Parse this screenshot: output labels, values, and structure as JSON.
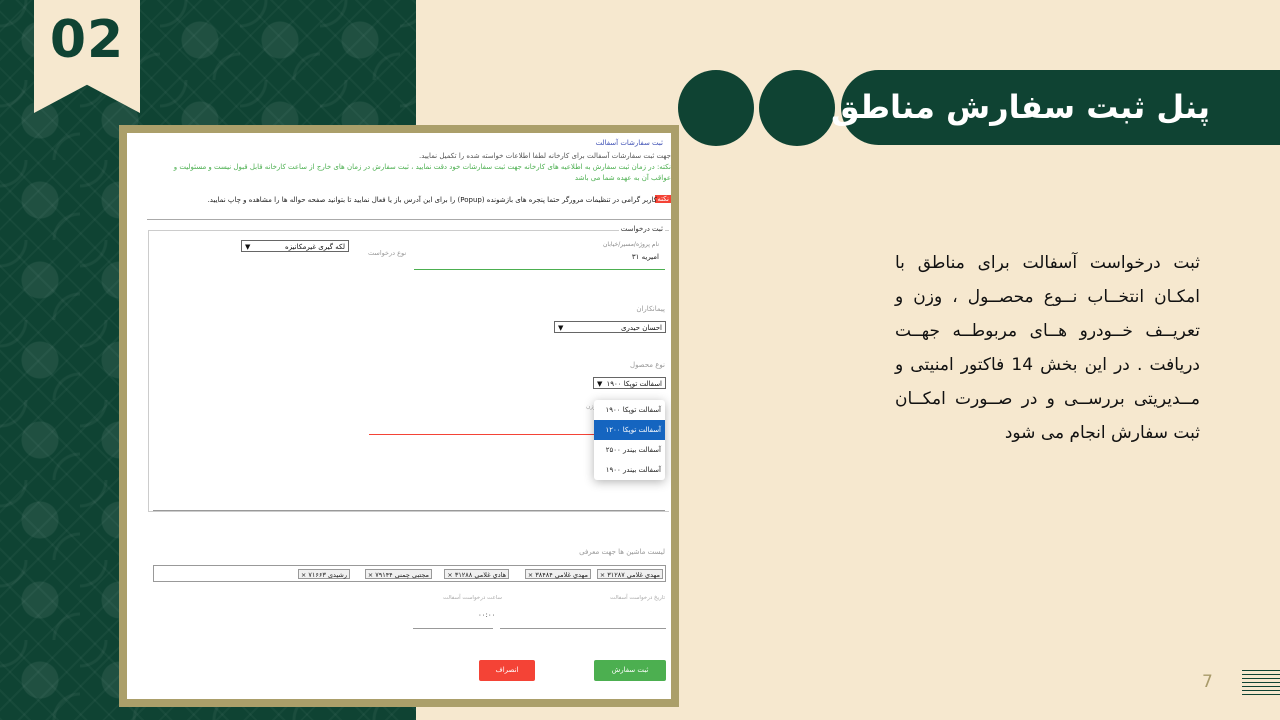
{
  "slide": {
    "number": "02",
    "title": "پنل ثبت سفارش مناطق",
    "description": "ثبت درخواست آسفالت برای مناطق با امکـان انتخــاب نــوع محصــول ، وزن و تعریــف خــودرو هــای مربوطــه جهــت دریافت . در این بخش 14 فاکتور امنیتی و مــدیریتی بررســی و در صــورت امکــان ثبت سفارش انجام می شود",
    "page_number": "7"
  },
  "screenshot": {
    "header_title": "ثبت سفارشات آسفالت",
    "intro_line": "جهت ثبت سفارشات آسفالت برای کارخانه لطفا اطلاعات خواسته شده را تکمیل نمایید.",
    "note_line1": "نکته: در زمان ثبت سفارش به اطلاعیه های کارخانه جهت ثبت سفارشات خود دقت نمایید ، ثبت سفارش در زمان های خارج از ساعت کارخانه قابل قبول نیست و مسئولیت و",
    "note_line2": "عواقب آن به عهده شما می باشد",
    "warning_badge": "نکته",
    "warning_text": "کاربر گرامی در تنظیمات مرورگر حتما پنجره های بازشونده (Popup) را برای این آدرس باز یا فعال نمایید تا بتوانید صفحه حواله ها را مشاهده و چاپ نمایید.",
    "section_title": "ثبت درخواست",
    "project_label": "نام پروژه/مسیر/خیابان",
    "project_value": "امیریه ۳۱",
    "request_type_label": "نوع درخواست",
    "request_type_value": "لکه گیری غیرمکانیزه",
    "contractor_label": "پیمانکاران",
    "contractor_value": "احسان حیدری",
    "product_label": "نوع محصول",
    "product_value": "اسفالت توپکا ۱۹۰۰",
    "product_options": [
      "آسفالت توپکا ۱۹۰۰",
      "آسفالت توپکا ۱۲۰۰",
      "آسفالت بیندر ۲۵۰۰",
      "آسفالت بیندر ۱۹۰۰"
    ],
    "product_active_index": 1,
    "weight_label_partial": "وزن",
    "machines_label": "لیست ماشین ها جهت معرفی",
    "machines": [
      "مهدي غلامي ۳۱۲۸۷",
      "مهدي غلامي ۳۸۴۸۴",
      "هادي غلامي ۳۱۲۸۸",
      "مجتبی چمنی ۷۹۱۴۴",
      "رشیدی ۷۱۶۶۳"
    ],
    "date_label": "تاریخ درخواست آسفالت",
    "time_label": "ساعت درخواست آسفالت",
    "time_value": "۰۰:۰۰",
    "submit_label": "ثبت سفارش",
    "cancel_label": "انصراف"
  },
  "colors": {
    "dark_green": "#0f4333",
    "cream": "#f6e8cf",
    "frame": "#ab9f6a",
    "submit_green": "#4caf50",
    "cancel_red": "#f44336",
    "dropdown_active": "#1565c0"
  }
}
